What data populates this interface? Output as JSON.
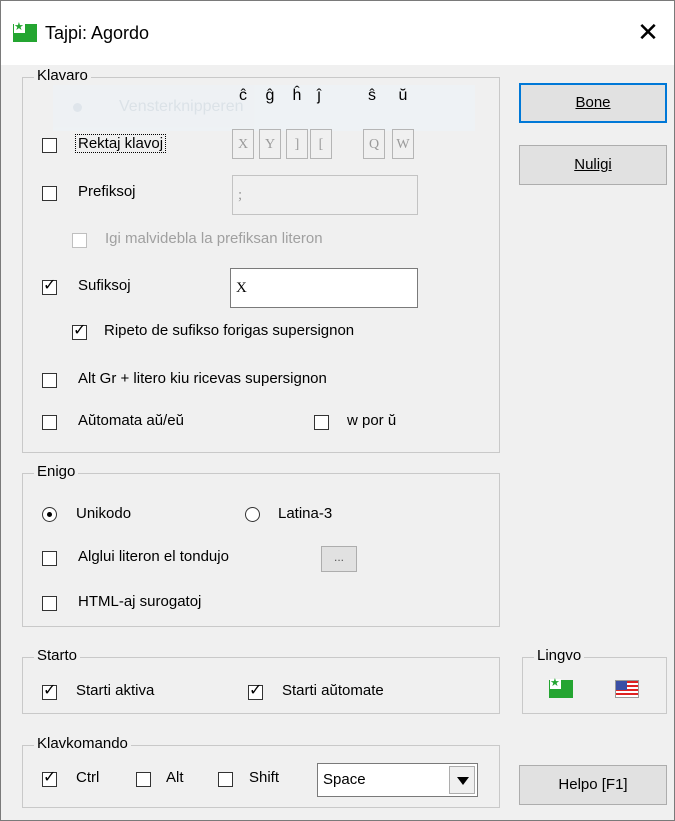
{
  "window": {
    "title": "Tajpi: Agordo",
    "close_symbol": "✕"
  },
  "ghost_tooltip": "Vensterknipperen",
  "klavaro": {
    "legend": "Klavaro",
    "supersign_chars": [
      "ĉ",
      "ĝ",
      "ĥ",
      "ĵ",
      "ŝ",
      "ŭ"
    ],
    "rektaj": {
      "label": "Rektaj klavoj",
      "checked": false,
      "keys": [
        "X",
        "Y",
        "]",
        "[",
        "Q",
        "W"
      ]
    },
    "prefiksoj": {
      "label": "Prefiksoj",
      "checked": false,
      "value": ";"
    },
    "igi_malvidebla": {
      "label": "Igi malvidebla la prefiksan literon",
      "checked": false,
      "disabled": true
    },
    "sufiksoj": {
      "label": "Sufiksoj",
      "checked": true,
      "value": "X"
    },
    "ripeto": {
      "label": "Ripeto de sufikso forigas supersignon",
      "checked": true
    },
    "altgr": {
      "label": "Alt Gr + litero kiu ricevas supersignon",
      "checked": false
    },
    "automata": {
      "label": "Aŭtomata aŭ/eŭ",
      "checked": false
    },
    "w_por": {
      "label": "w por ŭ",
      "checked": false
    }
  },
  "enigo": {
    "legend": "Enigo",
    "unikodo": {
      "label": "Unikodo",
      "selected": true
    },
    "latina3": {
      "label": "Latina-3",
      "selected": false
    },
    "alglui": {
      "label": "Alglui literon el tondujo",
      "checked": false,
      "button": "..."
    },
    "html": {
      "label": "HTML-aj surogatoj",
      "checked": false
    }
  },
  "starto": {
    "legend": "Starto",
    "aktiva": {
      "label": "Starti aktiva",
      "checked": true
    },
    "automate": {
      "label": "Starti aŭtomate",
      "checked": true
    }
  },
  "klavkomando": {
    "legend": "Klavkomando",
    "ctrl": {
      "label": "Ctrl",
      "checked": true
    },
    "alt": {
      "label": "Alt",
      "checked": false
    },
    "shift": {
      "label": "Shift",
      "checked": false
    },
    "key_select": "Space"
  },
  "lingvo": {
    "legend": "Lingvo"
  },
  "buttons": {
    "bone": "Bone",
    "nuligi": "Nuligi",
    "helpo": "Helpo [F1]"
  },
  "colors": {
    "accent": "#0078d7",
    "flag_green": "#24a531",
    "disabled_text": "#a0a0a0"
  }
}
